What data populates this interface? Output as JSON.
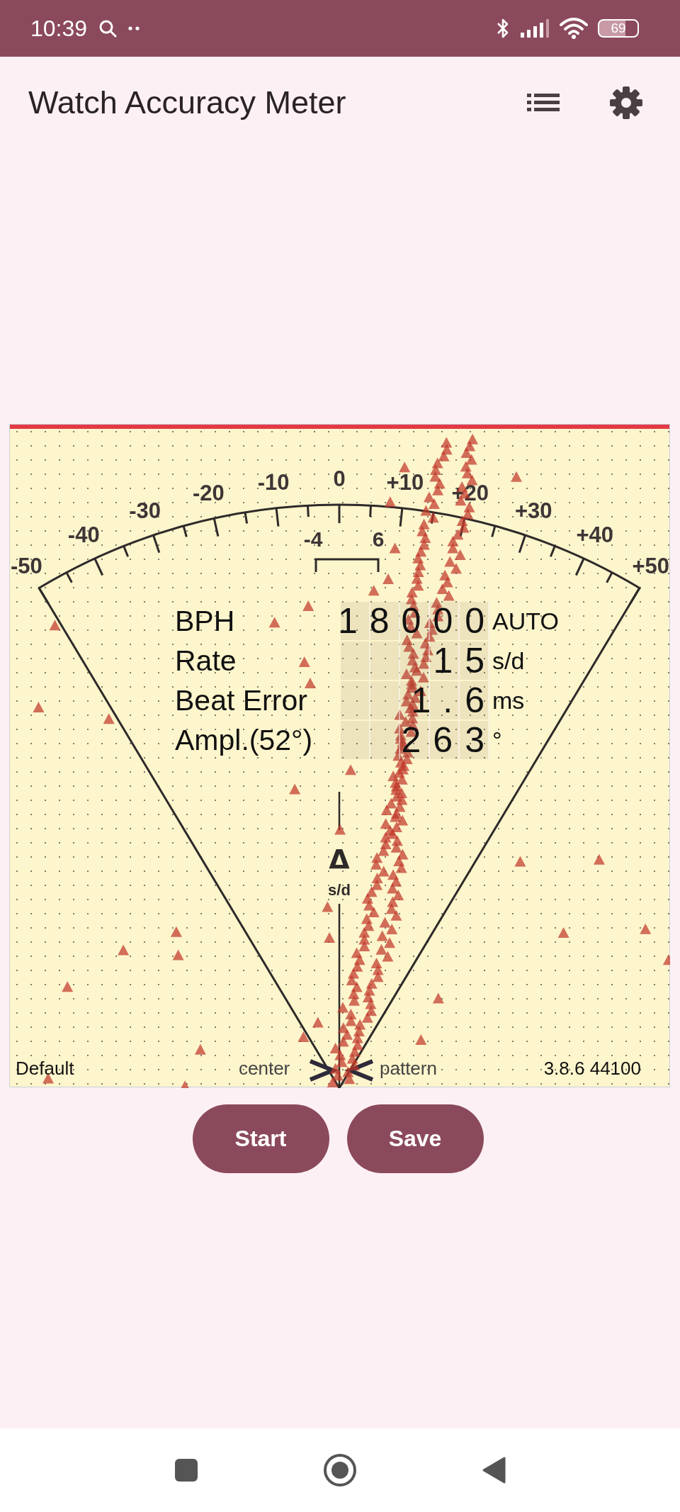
{
  "status_bar": {
    "time": "10:39",
    "battery": "69"
  },
  "app_bar": {
    "title": "Watch Accuracy Meter"
  },
  "meter": {
    "scale_labels": [
      "-50",
      "-40",
      "-30",
      "-20",
      "-10",
      "0",
      "+10",
      "+20",
      "+30",
      "+40",
      "+50"
    ],
    "tolerance": {
      "low_label": "-4",
      "high_label": "6"
    },
    "readout": [
      {
        "label": "BPH",
        "value": "18000",
        "unit": "AUTO"
      },
      {
        "label": "Rate",
        "value": "15",
        "unit": "s/d"
      },
      {
        "label": "Beat Error",
        "value": "1.6",
        "unit": "ms"
      },
      {
        "label": "Ampl.(52°)",
        "value": "263",
        "unit": "°"
      }
    ],
    "delta_symbol": "Δ",
    "delta_unit": "s/d",
    "footer": {
      "profile": "Default",
      "left_hint": "center",
      "right_hint": "pattern",
      "version": "3.8.6 44100"
    }
  },
  "buttons": [
    {
      "label": "Start"
    },
    {
      "label": "Save"
    }
  ]
}
